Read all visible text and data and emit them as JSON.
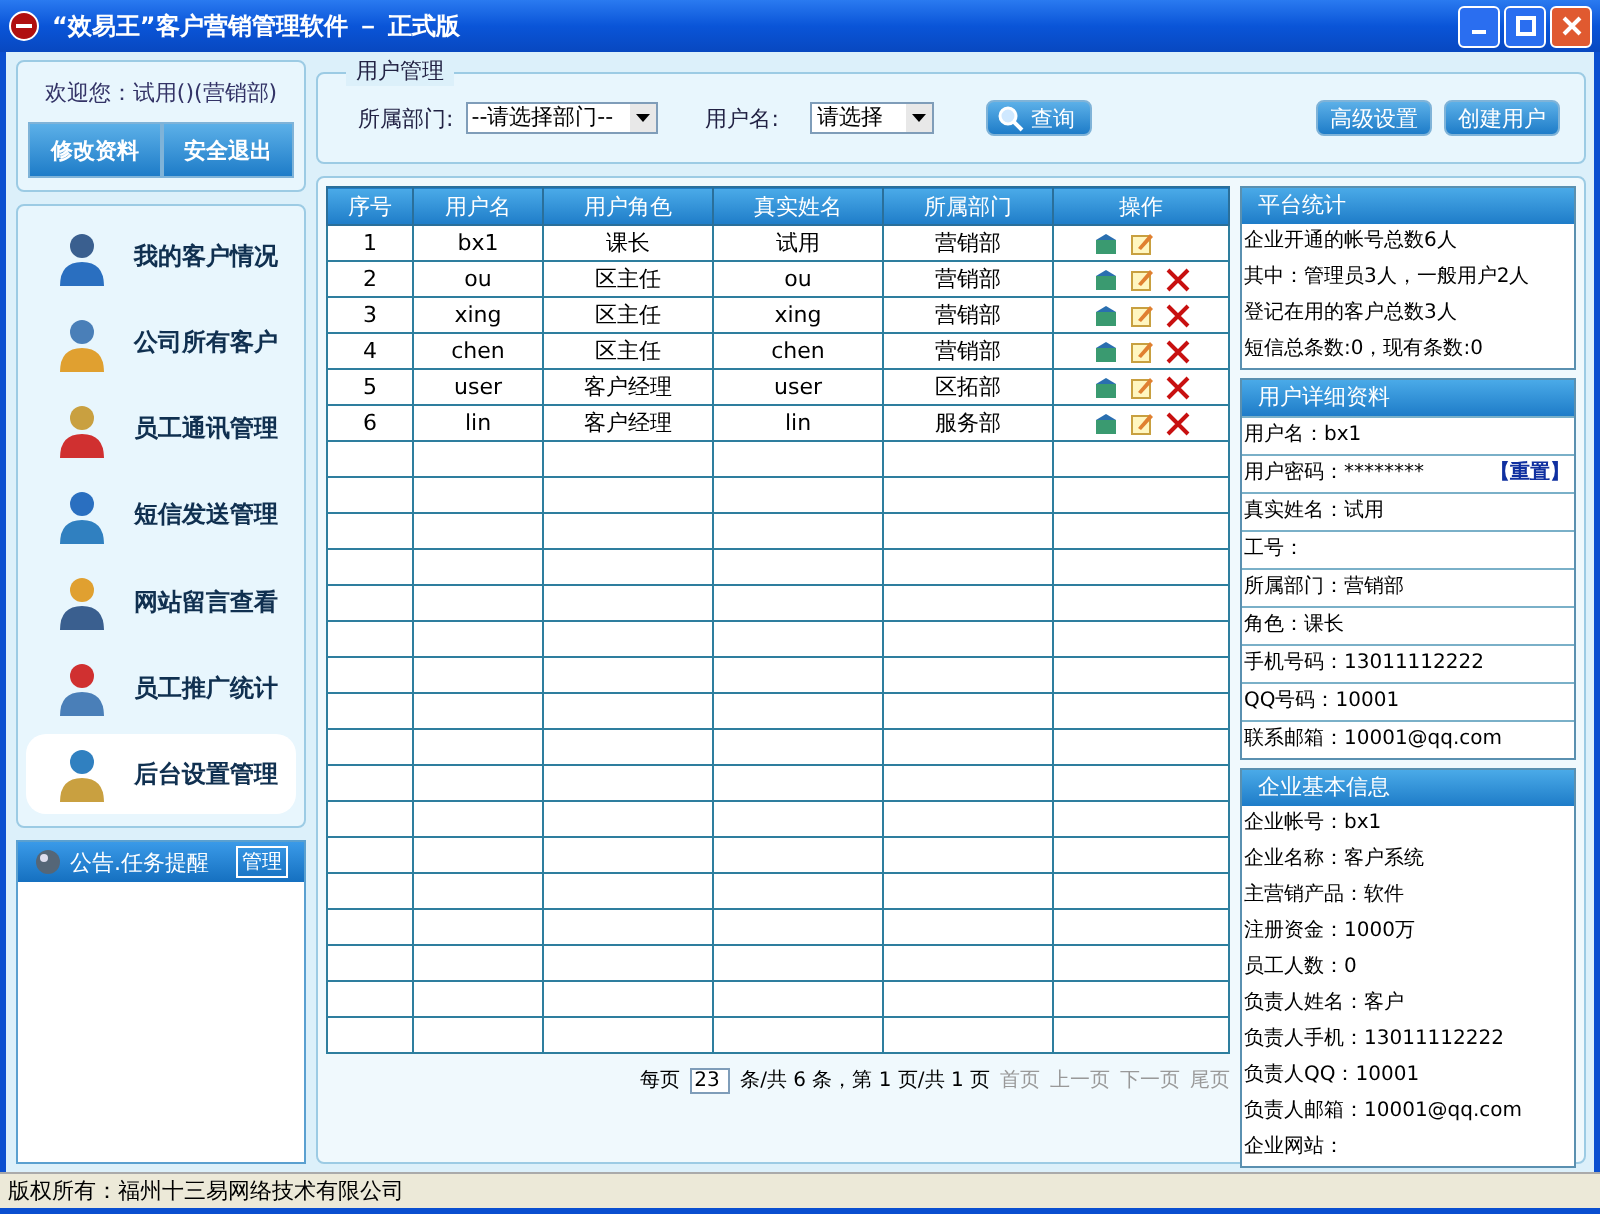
{
  "window": {
    "title": "“效易王”客户营销管理软件 － 正式版"
  },
  "account": {
    "welcome": "欢迎您：试用()(营销部)",
    "buttons": [
      "修改资料",
      "安全退出"
    ]
  },
  "menu": [
    {
      "label": "我的客户情况",
      "selected": false
    },
    {
      "label": "公司所有客户",
      "selected": false
    },
    {
      "label": "员工通讯管理",
      "selected": false
    },
    {
      "label": "短信发送管理",
      "selected": false
    },
    {
      "label": "网站留言查看",
      "selected": false
    },
    {
      "label": "员工推广统计",
      "selected": false
    },
    {
      "label": "后台设置管理",
      "selected": true
    }
  ],
  "notice": {
    "title": "公告.任务提醒",
    "manage": "管理"
  },
  "filter": {
    "legend": "用户管理",
    "dept_label": "所属部门:",
    "dept_value": "--请选择部门--",
    "user_label": "用户名:",
    "user_value": "请选择",
    "search": "查询",
    "buttons": [
      "高级设置",
      "创建用户"
    ]
  },
  "table": {
    "columns": [
      "序号",
      "用户名",
      "用户角色",
      "真实姓名",
      "所属部门",
      "操作"
    ],
    "rows": [
      {
        "cells": [
          "1",
          "bx1",
          "课长",
          "试用",
          "营销部"
        ],
        "deletable": false
      },
      {
        "cells": [
          "2",
          "ou",
          "区主任",
          "ou",
          "营销部"
        ],
        "deletable": true
      },
      {
        "cells": [
          "3",
          "xing",
          "区主任",
          "xing",
          "营销部"
        ],
        "deletable": true
      },
      {
        "cells": [
          "4",
          "chen",
          "区主任",
          "chen",
          "营销部"
        ],
        "deletable": true
      },
      {
        "cells": [
          "5",
          "user",
          "客户经理",
          "user",
          "区拓部"
        ],
        "deletable": true
      },
      {
        "cells": [
          "6",
          "lin",
          "客户经理",
          "lin",
          "服务部"
        ],
        "deletable": true
      }
    ]
  },
  "pager": {
    "per_page_label": "每页",
    "per_page": "23",
    "summary": "条/共 6 条，第 1 页/共 1 页",
    "links": [
      {
        "label": "首页",
        "disabled": true
      },
      {
        "label": "上一页",
        "disabled": true
      },
      {
        "label": "下一页",
        "disabled": true
      },
      {
        "label": "尾页",
        "disabled": true
      }
    ]
  },
  "stats": {
    "title": "平台统计",
    "lines": [
      "企业开通的帐号总数6人",
      "其中：管理员3人，一般用户2人",
      "登记在用的客户总数3人",
      "短信总条数:0，现有条数:0"
    ]
  },
  "user_detail": {
    "title": "用户详细资料",
    "rows": [
      {
        "text": "用户名：bx1"
      },
      {
        "text": "用户密码：********",
        "link": "【重置】"
      },
      {
        "text": "真实姓名：试用"
      },
      {
        "text": "工号："
      },
      {
        "text": "所属部门：营销部"
      },
      {
        "text": "角色：课长"
      },
      {
        "text": "手机号码：13011112222"
      },
      {
        "text": "QQ号码：10001"
      },
      {
        "text": "联系邮箱：10001@qq.com"
      }
    ]
  },
  "company": {
    "title": "企业基本信息",
    "rows": [
      "企业帐号：bx1",
      "企业名称：客户系统",
      "主营销产品：软件",
      "注册资金：1000万",
      "员工人数：0",
      "负责人姓名：客户",
      "负责人手机：13011112222",
      "负责人QQ：10001",
      "负责人邮箱：10001@qq.com",
      "企业网站："
    ]
  },
  "status_bar": "版权所有：福州十三易网络技术有限公司"
}
